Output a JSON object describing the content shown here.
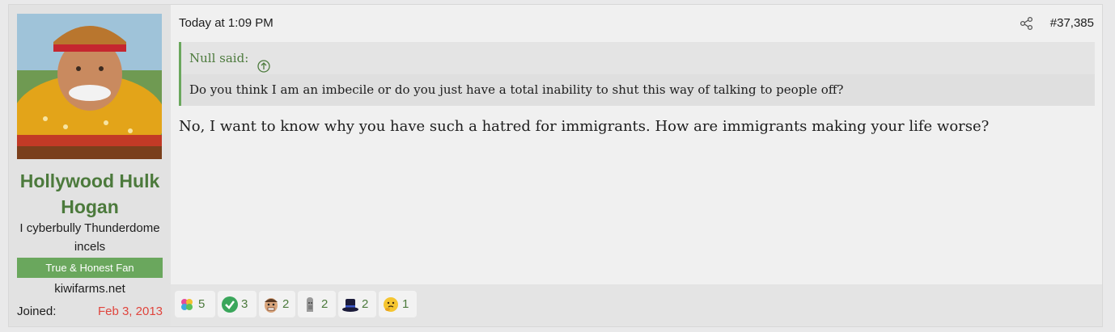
{
  "user": {
    "name": "Hollywood Hulk Hogan",
    "title": "I cyberbully Thunderdome incels",
    "banner": "True & Honest Fan",
    "site": "kiwifarms.net",
    "joined_label": "Joined:",
    "joined_date": "Feb 3, 2013"
  },
  "post": {
    "date": "Today at 1:09 PM",
    "number": "#37,385",
    "quote": {
      "author": "Null said:",
      "text": "Do you think I am an imbecile or do you just have a total inability to shut this way of talking to people off?"
    },
    "body": "No, I want to know why you have such a hatred for immigrants. How are immigrants making your life worse?"
  },
  "reactions": [
    {
      "icon": "sparkles-icon",
      "count": "5"
    },
    {
      "icon": "checkmark-icon",
      "count": "3"
    },
    {
      "icon": "face-icon",
      "count": "2"
    },
    {
      "icon": "statue-icon",
      "count": "2"
    },
    {
      "icon": "top-hat-icon",
      "count": "2"
    },
    {
      "icon": "thinking-face-icon",
      "count": "1"
    }
  ],
  "colors": {
    "accent": "#4c7a3c",
    "banner": "#6aa75d",
    "date_red": "#e0453d"
  }
}
